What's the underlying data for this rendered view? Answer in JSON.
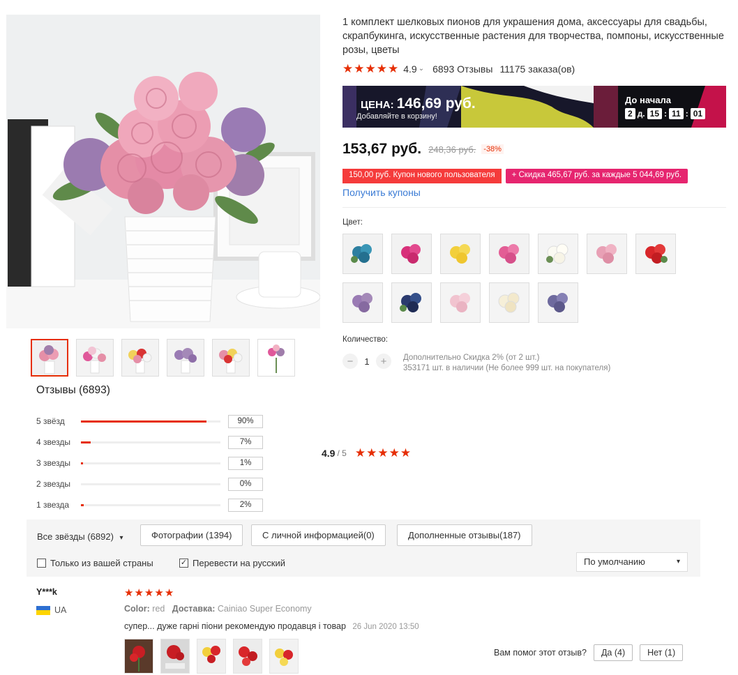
{
  "product": {
    "title": "1 комплект шелковых пионов для украшения дома, аксессуары для свадьбы, скрапбукинга, искусственные растения для творчества, помпоны, искусственные розы, цветы",
    "rating": "4.9",
    "reviews": "6893 Отзывы",
    "orders": "11175 заказа(ов)"
  },
  "promo": {
    "price_label": "ЦЕНА:",
    "price_value": "146,69 руб.",
    "add_to_cart": "Добавляйте в корзину!",
    "starts_in": "До начала",
    "days": "2",
    "days_unit": "д.",
    "hours": "15",
    "minutes": "11",
    "seconds": "01"
  },
  "price": {
    "current": "153,67 руб.",
    "original": "248,36 руб.",
    "discount": "-38%"
  },
  "coupons": {
    "new_user": "150,00 руб. Купон нового пользователя",
    "spend_discount": "+ Скидка 465,67 руб. за каждые 5 044,69 руб.",
    "get_link": "Получить купоны"
  },
  "options": {
    "color_label": "Цвет:",
    "colors": [
      "blue",
      "rose-red",
      "yellow",
      "pink",
      "white",
      "light-pink",
      "red",
      "purple",
      "dark-blue",
      "pale-pink",
      "ivory",
      "lavender"
    ],
    "quantity_label": "Количество:",
    "quantity_value": "1",
    "extra_discount": "Дополнительно Скидка 2% (от 2 шт.)",
    "stock": "353171 шт. в наличии (Не более 999 шт. на покупателя)"
  },
  "reviews_summary": {
    "title": "Отзывы (6893)",
    "avg": "4.9",
    "out_of": "/ 5",
    "distribution": [
      {
        "label": "5 звёзд",
        "pct": "90%",
        "fraction": 0.9
      },
      {
        "label": "4 звезды",
        "pct": "7%",
        "fraction": 0.07
      },
      {
        "label": "3 звезды",
        "pct": "1%",
        "fraction": 0.01
      },
      {
        "label": "2 звезды",
        "pct": "0%",
        "fraction": 0.0
      },
      {
        "label": "1 звезда",
        "pct": "2%",
        "fraction": 0.02
      }
    ]
  },
  "filters": {
    "all_stars": "Все звёзды (6892)",
    "photos": "Фотографии (1394)",
    "personal_info": "С личной информацией(0)",
    "additional": "Дополненные отзывы(187)",
    "own_country": "Только из вашей страны",
    "translate": "Перевести на русский",
    "sort": "По умолчанию"
  },
  "review": {
    "user": "Y***k",
    "country": "UA",
    "color_label": "Color:",
    "color_value": "red",
    "shipping_label": "Доставка:",
    "shipping_value": "Cainiao Super Economy",
    "text": "супер... дуже гарні піони рекомендую продавця і товар",
    "date": "26 Jun 2020 13:50",
    "helpful_question": "Вам помог этот отзыв?",
    "yes": "Да (4)",
    "no": "Нет (1)"
  },
  "colors": {
    "accent": "#e62e04",
    "link": "#3a7bd5",
    "coupon_red": "#f53b3b",
    "coupon_pink": "#e6256f"
  }
}
